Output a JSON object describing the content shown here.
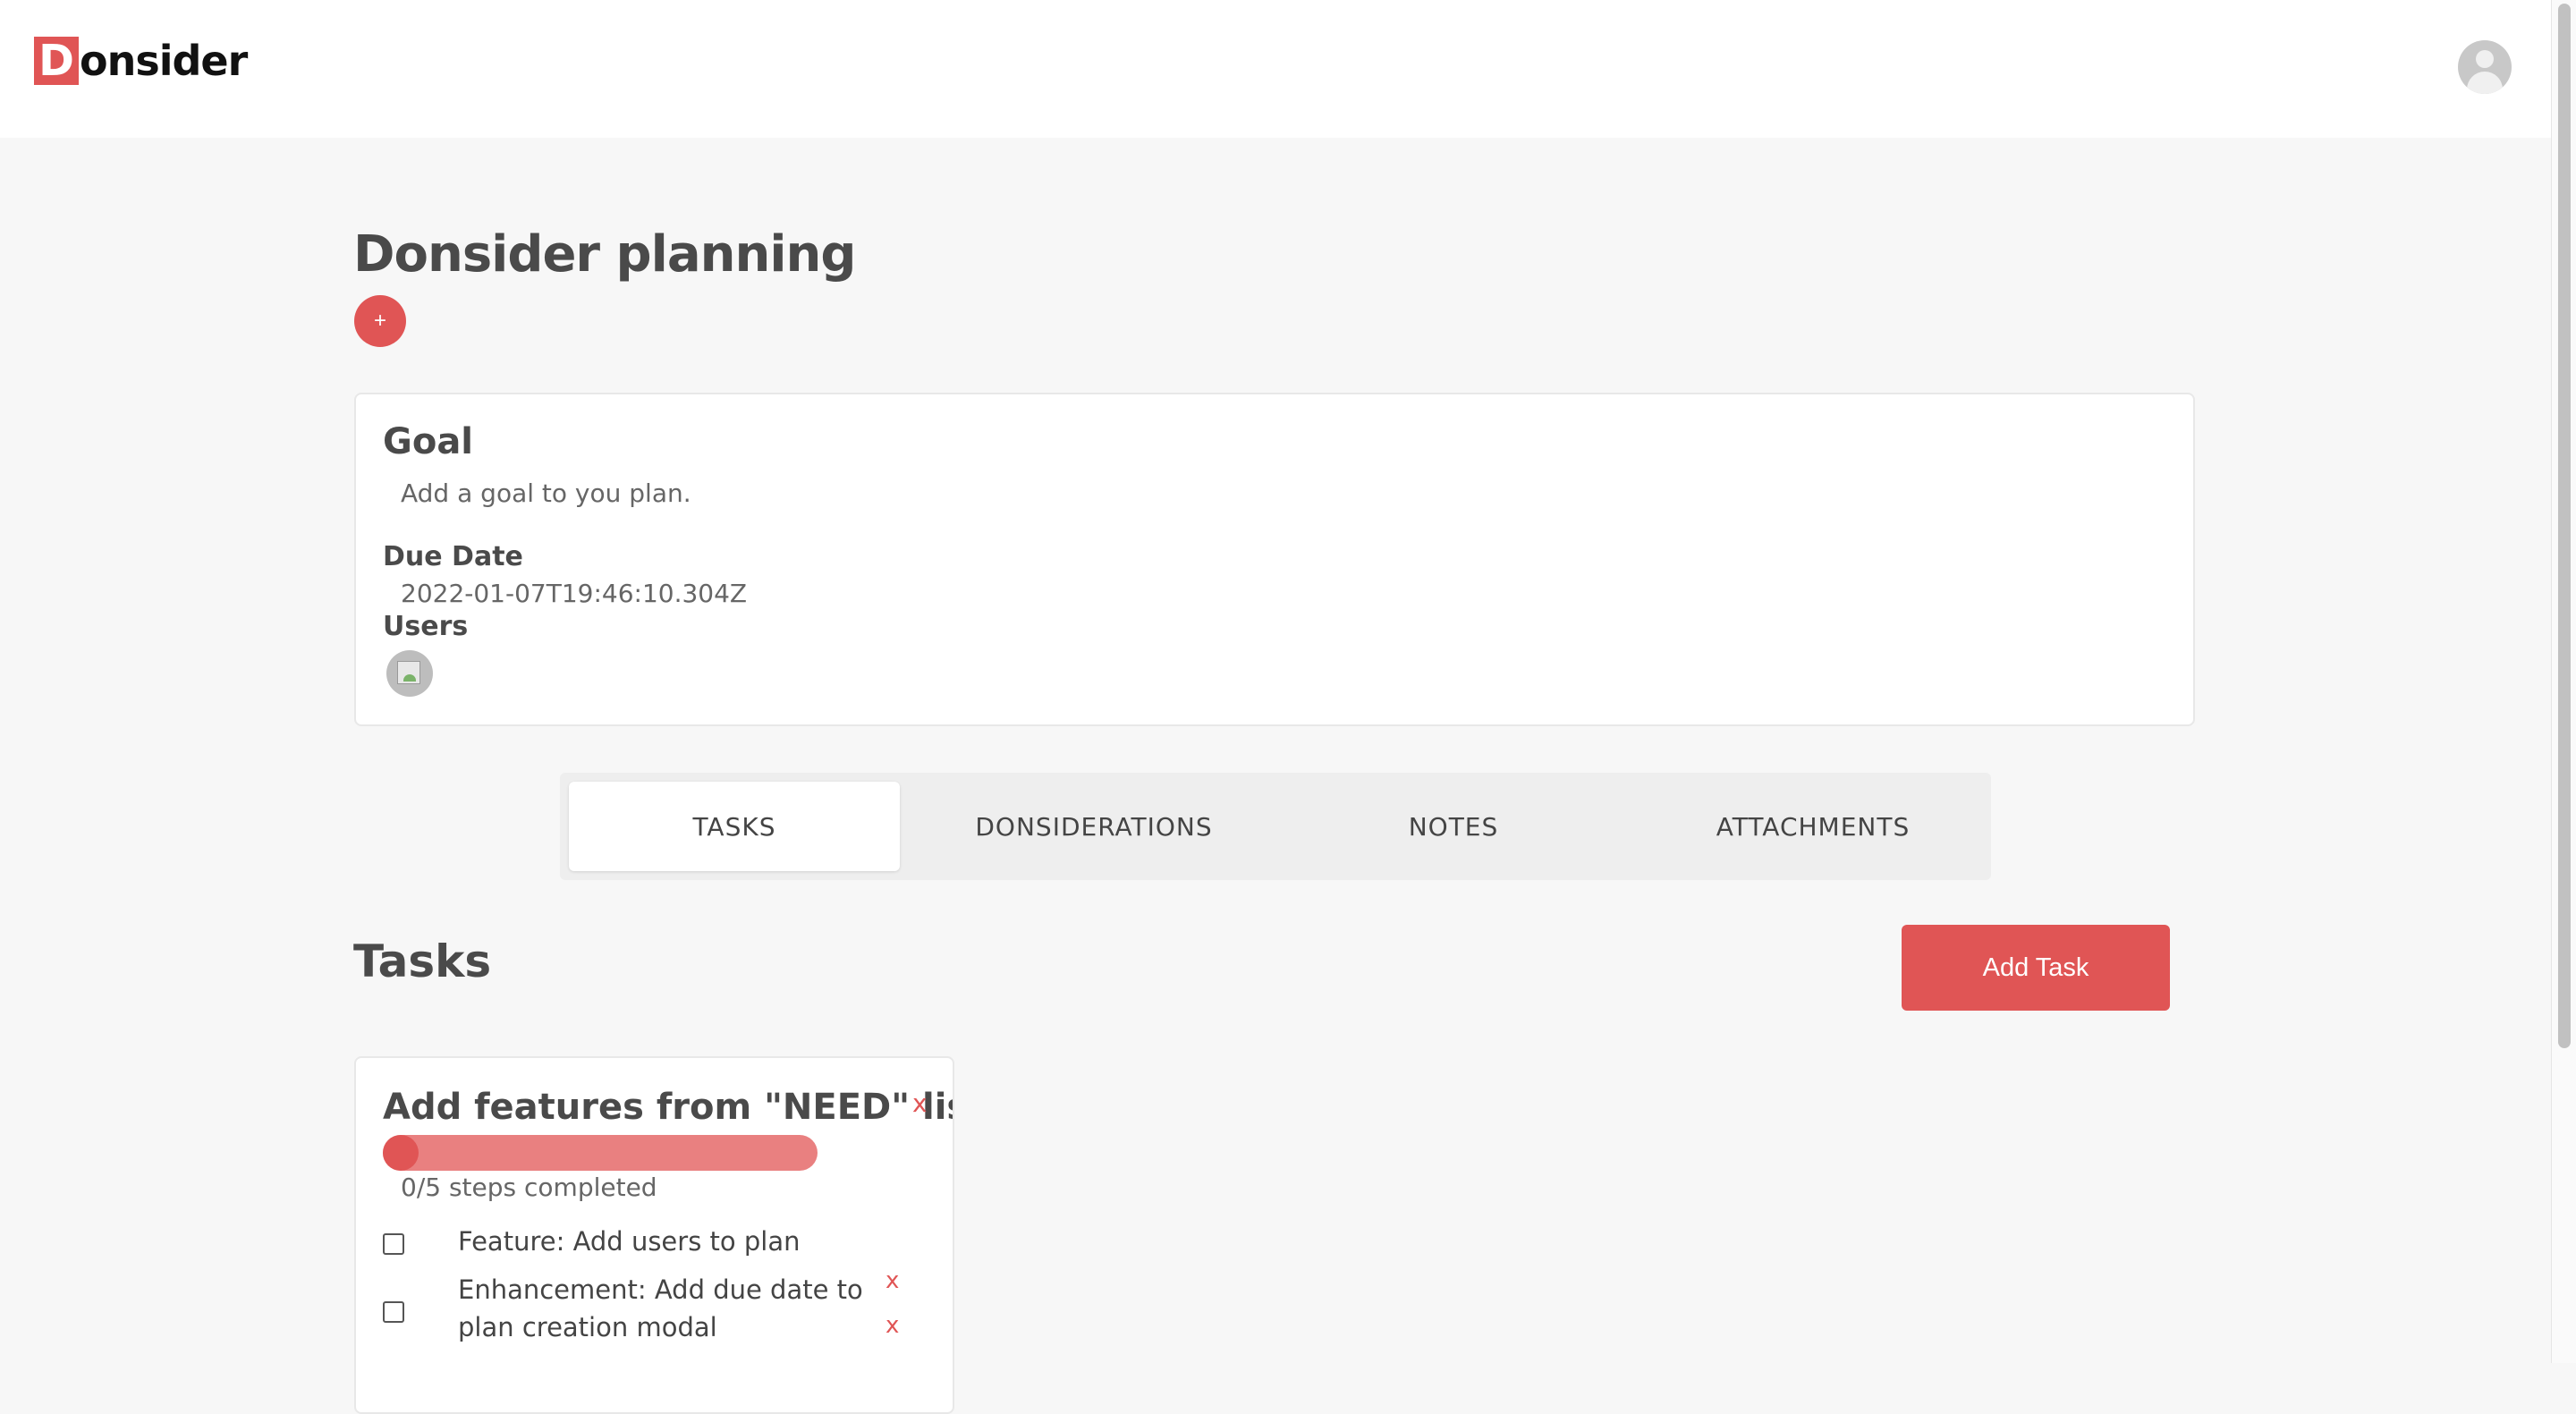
{
  "app": {
    "logo_letter": "D",
    "logo_rest": "onsider"
  },
  "page": {
    "title": "Donsider planning",
    "add_icon": "+"
  },
  "goal": {
    "title": "Goal",
    "text": "Add a goal to you plan.",
    "due_label": "Due Date",
    "due_value": "2022-01-07T19:46:10.304Z",
    "users_label": "Users"
  },
  "tabs": [
    {
      "label": "TASKS",
      "active": true
    },
    {
      "label": "DONSIDERATIONS",
      "active": false
    },
    {
      "label": "NOTES",
      "active": false
    },
    {
      "label": "ATTACHMENTS",
      "active": false
    }
  ],
  "tasks": {
    "title": "Tasks",
    "add_label": "Add Task",
    "items": [
      {
        "title": "Add features from \"NEED\" list",
        "delete_label": "x",
        "progress_fraction": 0.0,
        "progress_text": "0/5 steps completed",
        "steps": [
          {
            "text": "Feature: Add users to plan",
            "checked": false,
            "delete_label": "x"
          },
          {
            "text": "Enhancement: Add due date to plan creation modal",
            "checked": false,
            "delete_label": "x"
          }
        ]
      }
    ]
  },
  "colors": {
    "accent": "#e05555",
    "progress_track": "#e98080",
    "background": "#f7f7f7"
  }
}
